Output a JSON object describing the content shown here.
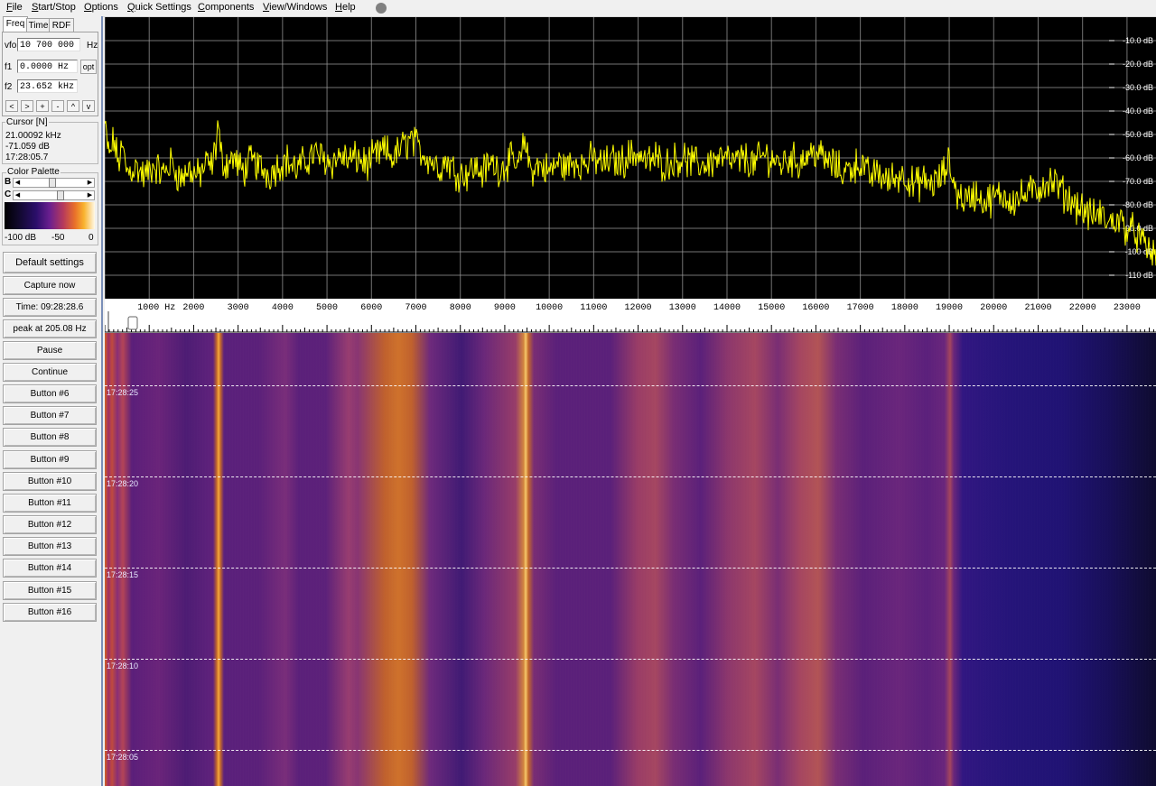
{
  "menu": {
    "items": [
      {
        "label": "File",
        "accel": "F"
      },
      {
        "label": "Start/Stop",
        "accel": "S"
      },
      {
        "label": "Options",
        "accel": "O"
      },
      {
        "label": "Quick Settings",
        "accel": "Q"
      },
      {
        "label": "Components",
        "accel": "C"
      },
      {
        "label": "View/Windows",
        "accel": "V"
      },
      {
        "label": "Help",
        "accel": "H"
      }
    ]
  },
  "tabs": {
    "freq": "Freq",
    "time": "Time",
    "rdf": "RDF"
  },
  "vfo": {
    "label": "vfo",
    "value": "10 700 000",
    "unit": "Hz"
  },
  "f1": {
    "label": "f1",
    "value": "0.0000 Hz",
    "opt": "opt"
  },
  "f2": {
    "label": "f2",
    "value": "23.652 kHz"
  },
  "nav_buttons": [
    "<",
    ">",
    "+",
    "-",
    "^",
    "v"
  ],
  "cursor": {
    "title": "Cursor [N]",
    "freq": "21.00092 kHz",
    "level": "-71.059 dB",
    "time": "17:28:05.7"
  },
  "palette": {
    "title": "Color Palette",
    "b_label": "B",
    "c_label": "C",
    "scale_min": "-100 dB",
    "scale_mid": "-50",
    "scale_max": "0",
    "brightness": 0.45,
    "contrast": 0.6
  },
  "buttons": {
    "default_settings": "Default settings",
    "capture_now": "Capture now",
    "time": "Time:  09:28:28.6",
    "peak": "peak at 205.08 Hz",
    "pause": "Pause",
    "continue": "Continue",
    "b6": "Button #6",
    "b7": "Button #7",
    "b8": "Button #8",
    "b9": "Button #9",
    "b10": "Button #10",
    "b11": "Button #11",
    "b12": "Button #12",
    "b13": "Button #13",
    "b14": "Button #14",
    "b15": "Button #15",
    "b16": "Button #16"
  },
  "waterfall": {
    "time_labels": [
      "17:28:25",
      "17:28:20",
      "17:28:15",
      "17:28:10",
      "17:28:05"
    ]
  },
  "colors": {
    "trace": "#ffff00",
    "grid": "#9a9a9a",
    "dB_labels": "#ffffff",
    "panel_border": "#7a8fb8"
  },
  "chart_data": {
    "type": "line",
    "title": "",
    "xlabel": "Hz",
    "ylabel": "dB",
    "x_unit": "Hz",
    "xlim": [
      0,
      23652
    ],
    "ylim": [
      -120,
      0
    ],
    "x_ticks": [
      1000,
      2000,
      3000,
      4000,
      5000,
      6000,
      7000,
      8000,
      9000,
      10000,
      11000,
      12000,
      13000,
      14000,
      15000,
      16000,
      17000,
      18000,
      19000,
      20000,
      21000,
      22000,
      23000
    ],
    "x_tick_labels": [
      "1000 Hz",
      "2000",
      "3000",
      "4000",
      "5000",
      "6000",
      "7000",
      "8000",
      "9000",
      "10000",
      "11000",
      "12000",
      "13000",
      "14000",
      "15000",
      "16000",
      "17000",
      "18000",
      "19000",
      "20000",
      "21000",
      "22000",
      "23000"
    ],
    "y_ticks": [
      -10,
      -20,
      -30,
      -40,
      -50,
      -60,
      -70,
      -80,
      -90,
      -100,
      -110
    ],
    "y_tick_labels": [
      "-10.0 dB",
      "-20.0 dB",
      "-30.0 dB",
      "-40.0 dB",
      "-50.0 dB",
      "-60.0 dB",
      "-70.0 dB",
      "-80.0 dB",
      "-90.0 dB",
      "-100 dB",
      "-110 dB"
    ],
    "grid": true,
    "series": [
      {
        "x": [
          0,
          100,
          200,
          300,
          400,
          500,
          700,
          900,
          1100,
          1300,
          1500,
          1700,
          1900,
          2100,
          2300,
          2400,
          2500,
          2550,
          2600,
          2700,
          2900,
          3100,
          3300,
          3500,
          3700,
          3900,
          4100,
          4300,
          4500,
          4700,
          4900,
          5100,
          5300,
          5500,
          5700,
          5900,
          6100,
          6300,
          6500,
          6700,
          6900,
          7100,
          7300,
          7500,
          7700,
          7900,
          8100,
          8300,
          8500,
          8700,
          8900,
          9100,
          9300,
          9400,
          9450,
          9500,
          9600,
          9800,
          10000,
          10200,
          10400,
          10600,
          10800,
          11000,
          11200,
          11400,
          11600,
          11800,
          12000,
          12200,
          12400,
          12600,
          12800,
          13000,
          13200,
          13400,
          13600,
          13800,
          14000,
          14200,
          14400,
          14600,
          14800,
          15000,
          15200,
          15400,
          15600,
          15800,
          16000,
          16200,
          16400,
          16600,
          16800,
          17000,
          17200,
          17400,
          17600,
          17800,
          18000,
          18200,
          18400,
          18600,
          18800,
          19000,
          19100,
          19200,
          19400,
          19600,
          19800,
          20000,
          20200,
          20400,
          20600,
          20800,
          21000,
          21200,
          21400,
          21600,
          21800,
          22000,
          22200,
          22400,
          22600,
          22800,
          23000,
          23200,
          23400,
          23652
        ],
        "y": [
          -46,
          -60,
          -52,
          -62,
          -56,
          -66,
          -64,
          -68,
          -63,
          -67,
          -62,
          -69,
          -65,
          -68,
          -62,
          -64,
          -55,
          -44,
          -58,
          -63,
          -60,
          -66,
          -61,
          -64,
          -67,
          -63,
          -61,
          -65,
          -62,
          -58,
          -60,
          -62,
          -59,
          -61,
          -60,
          -63,
          -59,
          -57,
          -60,
          -55,
          -52,
          -57,
          -60,
          -64,
          -61,
          -66,
          -67,
          -64,
          -66,
          -62,
          -65,
          -61,
          -64,
          -58,
          -50,
          -59,
          -65,
          -63,
          -66,
          -62,
          -64,
          -61,
          -63,
          -60,
          -63,
          -61,
          -62,
          -59,
          -58,
          -62,
          -60,
          -63,
          -61,
          -60,
          -62,
          -63,
          -62,
          -60,
          -61,
          -62,
          -60,
          -63,
          -59,
          -60,
          -63,
          -60,
          -62,
          -59,
          -57,
          -61,
          -63,
          -66,
          -64,
          -62,
          -68,
          -66,
          -70,
          -68,
          -67,
          -72,
          -70,
          -71,
          -69,
          -62,
          -70,
          -76,
          -78,
          -75,
          -79,
          -77,
          -76,
          -78,
          -77,
          -75,
          -73,
          -70,
          -71,
          -76,
          -79,
          -82,
          -85,
          -84,
          -88,
          -86,
          -90,
          -92,
          -98,
          -102
        ]
      }
    ]
  }
}
